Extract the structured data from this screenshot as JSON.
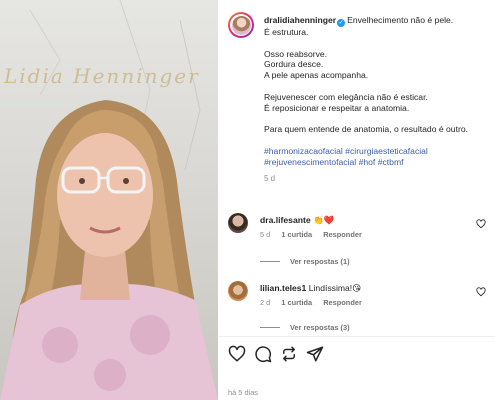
{
  "post": {
    "username": "dralidiahenninger",
    "caption_first_line": "Envelhecimento não é pele.",
    "caption_lines": [
      "É estrutura.",
      "",
      "Osso reabsorve.",
      "Gordura desce.",
      "A pele apenas acompanha.",
      "",
      "Rejuvenescer com elegância não é esticar.",
      "É reposicionar e respeitar a anatomia.",
      "",
      "Para quem entende de anatomia, o resultado é outro."
    ],
    "hashtags": "#harmonizacaofacial #cirurgiaesteticafacial #rejuvenescimentofacial #hof #ctbmf",
    "caption_age": "5 d",
    "posted_ago": "há 5 dias"
  },
  "media": {
    "logo_text": "Lidia Henninger"
  },
  "comments": [
    {
      "username": "dra.lifesante",
      "text": "👏❤️",
      "age": "5 d",
      "likes": "1 curtida",
      "reply_label": "Responder",
      "view_replies": "Ver respostas (1)"
    },
    {
      "username": "lilian.teles1",
      "text": "Lindíssima!😘",
      "age": "2 d",
      "likes": "1 curtida",
      "reply_label": "Responder",
      "view_replies": "Ver respostas (3)"
    }
  ],
  "actions": {
    "icons": [
      "heart-icon",
      "comment-icon",
      "repost-icon",
      "share-icon"
    ]
  },
  "colors": {
    "hashtag": "#3b5ea8",
    "verified": "#1d9bf0",
    "muted": "#8e8e8e"
  }
}
